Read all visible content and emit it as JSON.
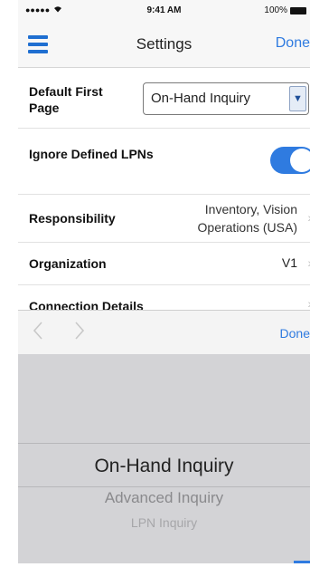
{
  "status_bar": {
    "signal": "●●●●●",
    "time": "9:41 AM",
    "battery_percent": "100%"
  },
  "nav": {
    "title": "Settings",
    "done_label": "Done"
  },
  "settings": {
    "default_first_page": {
      "label": "Default First Page",
      "value": "On-Hand Inquiry"
    },
    "ignore_defined_lpns": {
      "label": "Ignore Defined LPNs",
      "enabled": true
    },
    "responsibility": {
      "label": "Responsibility",
      "value_line1": "Inventory, Vision",
      "value_line2": "Operations (USA)"
    },
    "organization": {
      "label": "Organization",
      "value": "V1"
    },
    "connection_details": {
      "label": "Connection Details"
    }
  },
  "picker": {
    "done_label": "Done",
    "options": [
      "On-Hand Inquiry",
      "Advanced Inquiry",
      "LPN Inquiry"
    ],
    "selected": "On-Hand Inquiry"
  },
  "colors": {
    "accent": "#2f7be0",
    "menu_icon": "#1f6fd1",
    "picker_background": "#d3d3d6"
  }
}
